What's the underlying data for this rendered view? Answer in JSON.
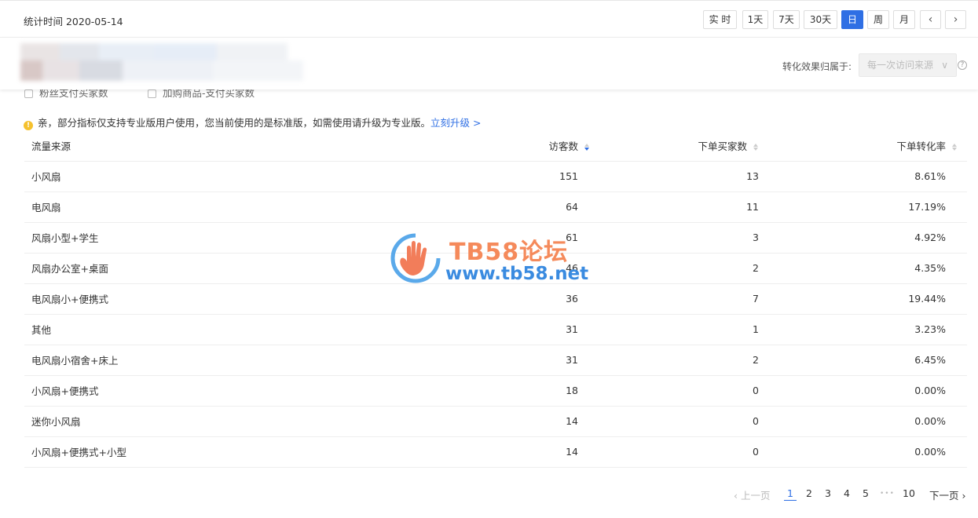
{
  "header": {
    "stat_time": "统计时间 2020-05-14",
    "ranges": [
      "实 时",
      "1天",
      "7天",
      "30天",
      "日",
      "周",
      "月"
    ],
    "active_range": "日",
    "prev": "‹",
    "next": "›"
  },
  "attribution": {
    "label": "转化效果归属于:",
    "value": "每一次访问来源",
    "chevron": "∨",
    "help": "?"
  },
  "checkboxes": [
    "粉丝支付买家数",
    "加购商品-支付买家数"
  ],
  "notice": {
    "text": "亲，部分指标仅支持专业版用户使用，您当前使用的是标准版，如需使用请升级为专业版。",
    "link": "立刻升级 >",
    "icon": "warning-icon"
  },
  "table": {
    "columns": [
      "流量来源",
      "访客数",
      "下单买家数",
      "下单转化率"
    ],
    "rows": [
      [
        "小风扇",
        "151",
        "13",
        "8.61%"
      ],
      [
        "电风扇",
        "64",
        "11",
        "17.19%"
      ],
      [
        "风扇小型+学生",
        "61",
        "3",
        "4.92%"
      ],
      [
        "风扇办公室+桌面",
        "46",
        "2",
        "4.35%"
      ],
      [
        "电风扇小+便携式",
        "36",
        "7",
        "19.44%"
      ],
      [
        "其他",
        "31",
        "1",
        "3.23%"
      ],
      [
        "电风扇小宿舍+床上",
        "31",
        "2",
        "6.45%"
      ],
      [
        "小风扇+便携式",
        "18",
        "0",
        "0.00%"
      ],
      [
        "迷你小风扇",
        "14",
        "0",
        "0.00%"
      ],
      [
        "小风扇+便携式+小型",
        "14",
        "0",
        "0.00%"
      ]
    ]
  },
  "watermark": {
    "title": "TB58论坛",
    "url": "www.tb58.net"
  },
  "pagination": {
    "prev": "‹ 上一页",
    "pages": [
      "1",
      "2",
      "3",
      "4",
      "5"
    ],
    "ellipsis": "•••",
    "last": "10",
    "next": "下一页 ›",
    "current": "1"
  },
  "colors": {
    "accent": "#2f6fe4",
    "warning": "#f5c12e",
    "watermark_orange": "#f58a5b",
    "watermark_blue": "#3a8be0"
  }
}
